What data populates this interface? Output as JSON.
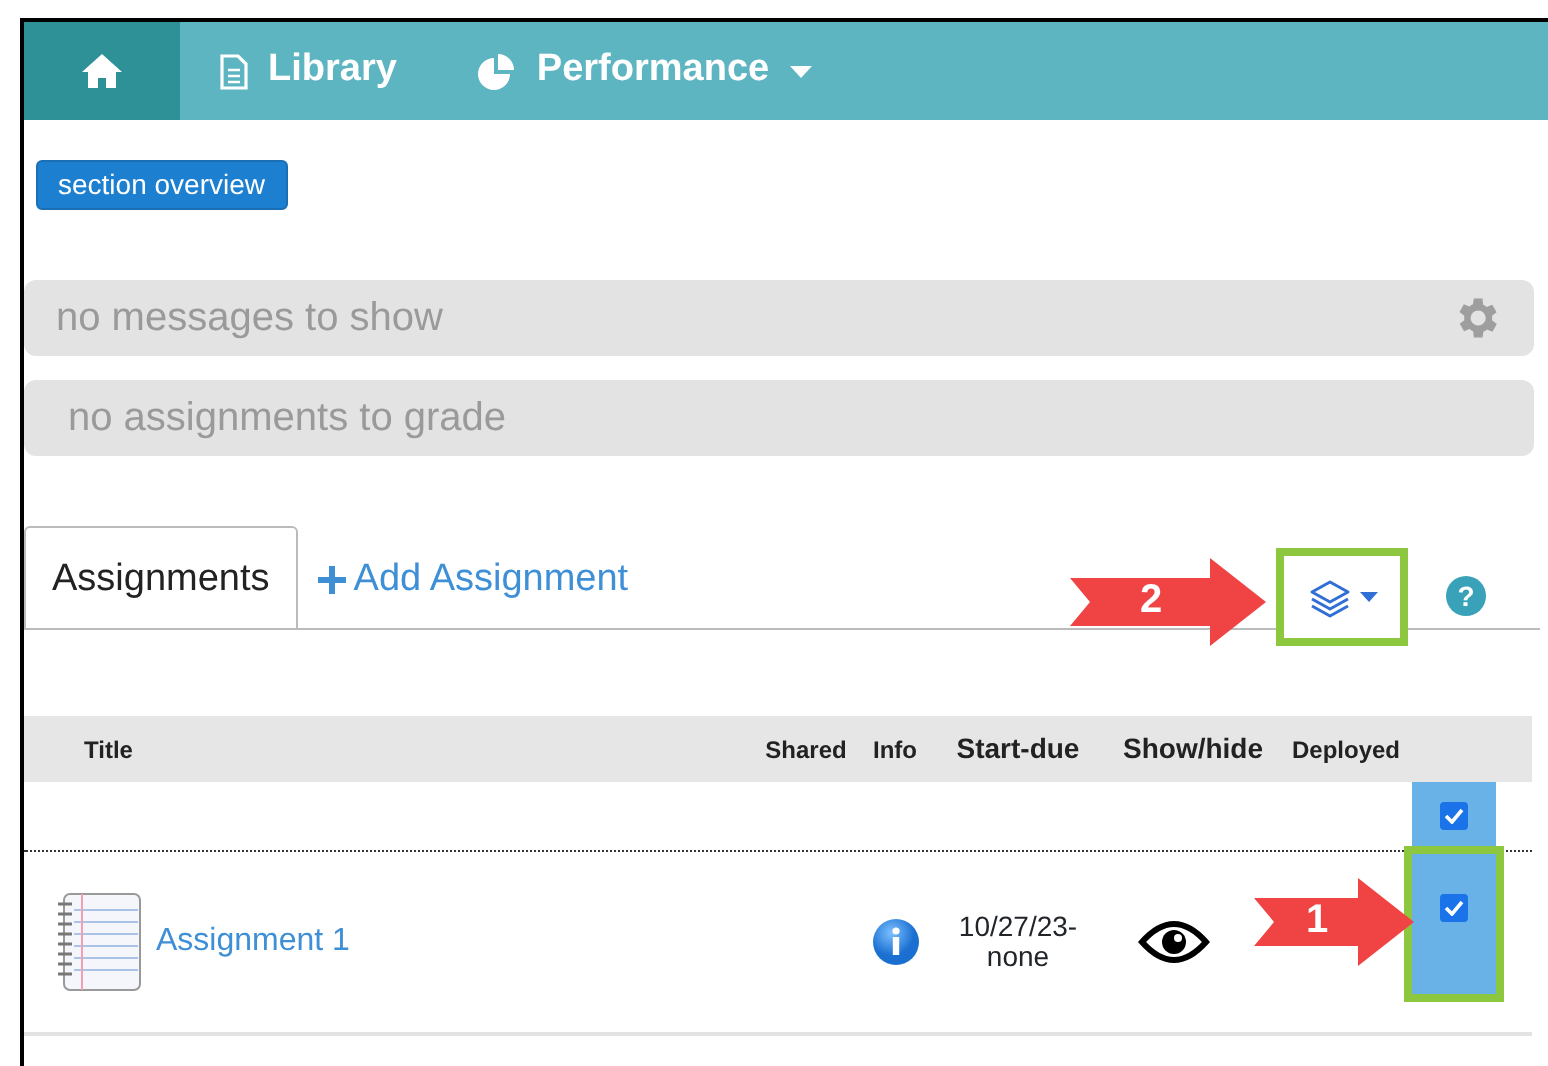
{
  "nav": {
    "items": [
      {
        "kind": "home",
        "selected": true
      },
      {
        "kind": "doc",
        "label": "Library",
        "selected": false
      },
      {
        "kind": "pie",
        "label": "Performance",
        "selected": false,
        "dropdown": true
      }
    ]
  },
  "section_button": "section overview",
  "notices": [
    {
      "text": "no messages to show",
      "kind": "gear"
    },
    {
      "text": "no assignments to grade",
      "kind": "plain"
    }
  ],
  "tabs": [
    {
      "label": "Assignments",
      "kind": "tab",
      "selected": true
    },
    {
      "label": "Add Assignment",
      "kind": "add",
      "selected": false
    }
  ],
  "help": "?",
  "callouts": [
    {
      "number": "2"
    },
    {
      "number": "1"
    }
  ],
  "table": {
    "columns": [
      "Title",
      "Shared",
      "Info",
      "Start-due",
      "Show/hide",
      "Deployed"
    ],
    "select_all_checked": true,
    "rows": [
      {
        "title": "Assignment 1",
        "start_due": "10/27/23-\nnone",
        "visible": true,
        "deployed": true
      }
    ]
  }
}
